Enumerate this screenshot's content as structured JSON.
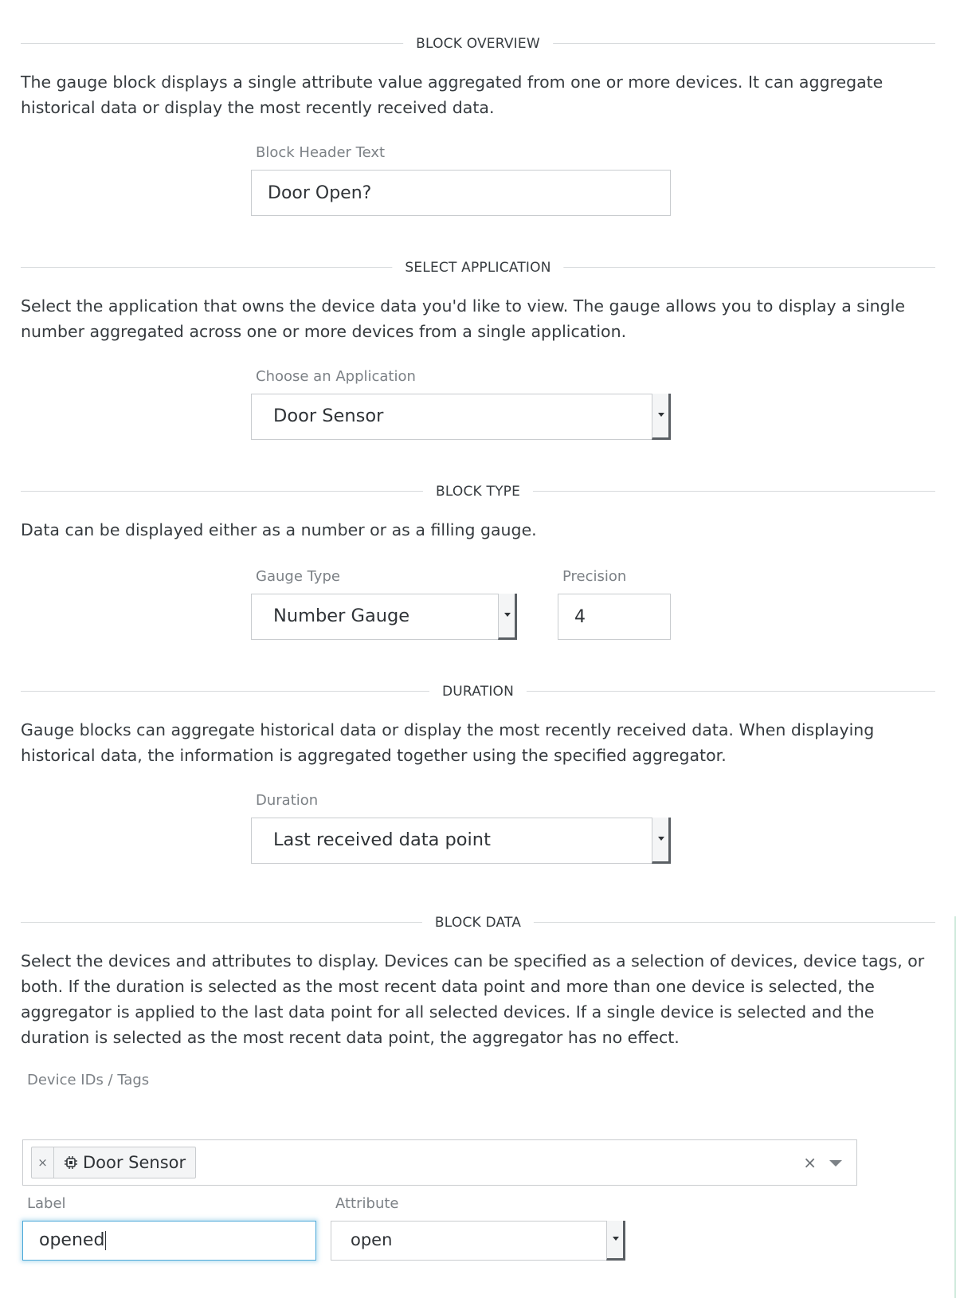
{
  "sections": {
    "overview": {
      "title": "BLOCK OVERVIEW",
      "description": "The gauge block displays a single attribute value aggregated from one or more devices. It can aggregate historical data or display the most recently received data.",
      "header_label": "Block Header Text",
      "header_value": "Door Open?"
    },
    "application": {
      "title": "SELECT APPLICATION",
      "description": "Select the application that owns the device data you'd like to view. The gauge allows you to display a single number aggregated across one or more devices from a single application.",
      "label": "Choose an Application",
      "selected": "Door Sensor"
    },
    "block_type": {
      "title": "BLOCK TYPE",
      "description": "Data can be displayed either as a number or as a filling gauge.",
      "gauge_label": "Gauge Type",
      "gauge_selected": "Number Gauge",
      "precision_label": "Precision",
      "precision_value": "4"
    },
    "duration": {
      "title": "DURATION",
      "description": "Gauge blocks can aggregate historical data or display the most recently received data. When displaying historical data, the information is aggregated together using the specified aggregator.",
      "label": "Duration",
      "selected": "Last received data point"
    },
    "block_data": {
      "title": "BLOCK DATA",
      "description": "Select the devices and attributes to display. Devices can be specified as a selection of devices, device tags, or both. If the duration is selected as the most recent data point and more than one device is selected, the aggregator is applied to the last data point for all selected devices. If a single device is selected and the duration is selected as the most recent data point, the aggregator has no effect.",
      "devices_label": "Device IDs / Tags",
      "device_tag": "Door Sensor",
      "tag_remove": "×",
      "clear_all": "×",
      "label_label": "Label",
      "label_value": "opened",
      "attribute_label": "Attribute",
      "attribute_selected": "open"
    }
  },
  "icons": {
    "tag_device": "chip-icon",
    "select_arrow": "caret-down-icon"
  },
  "colors": {
    "focus_border": "#4aa8d8",
    "divider": "#d7dadc",
    "label_text": "#7c8186"
  }
}
